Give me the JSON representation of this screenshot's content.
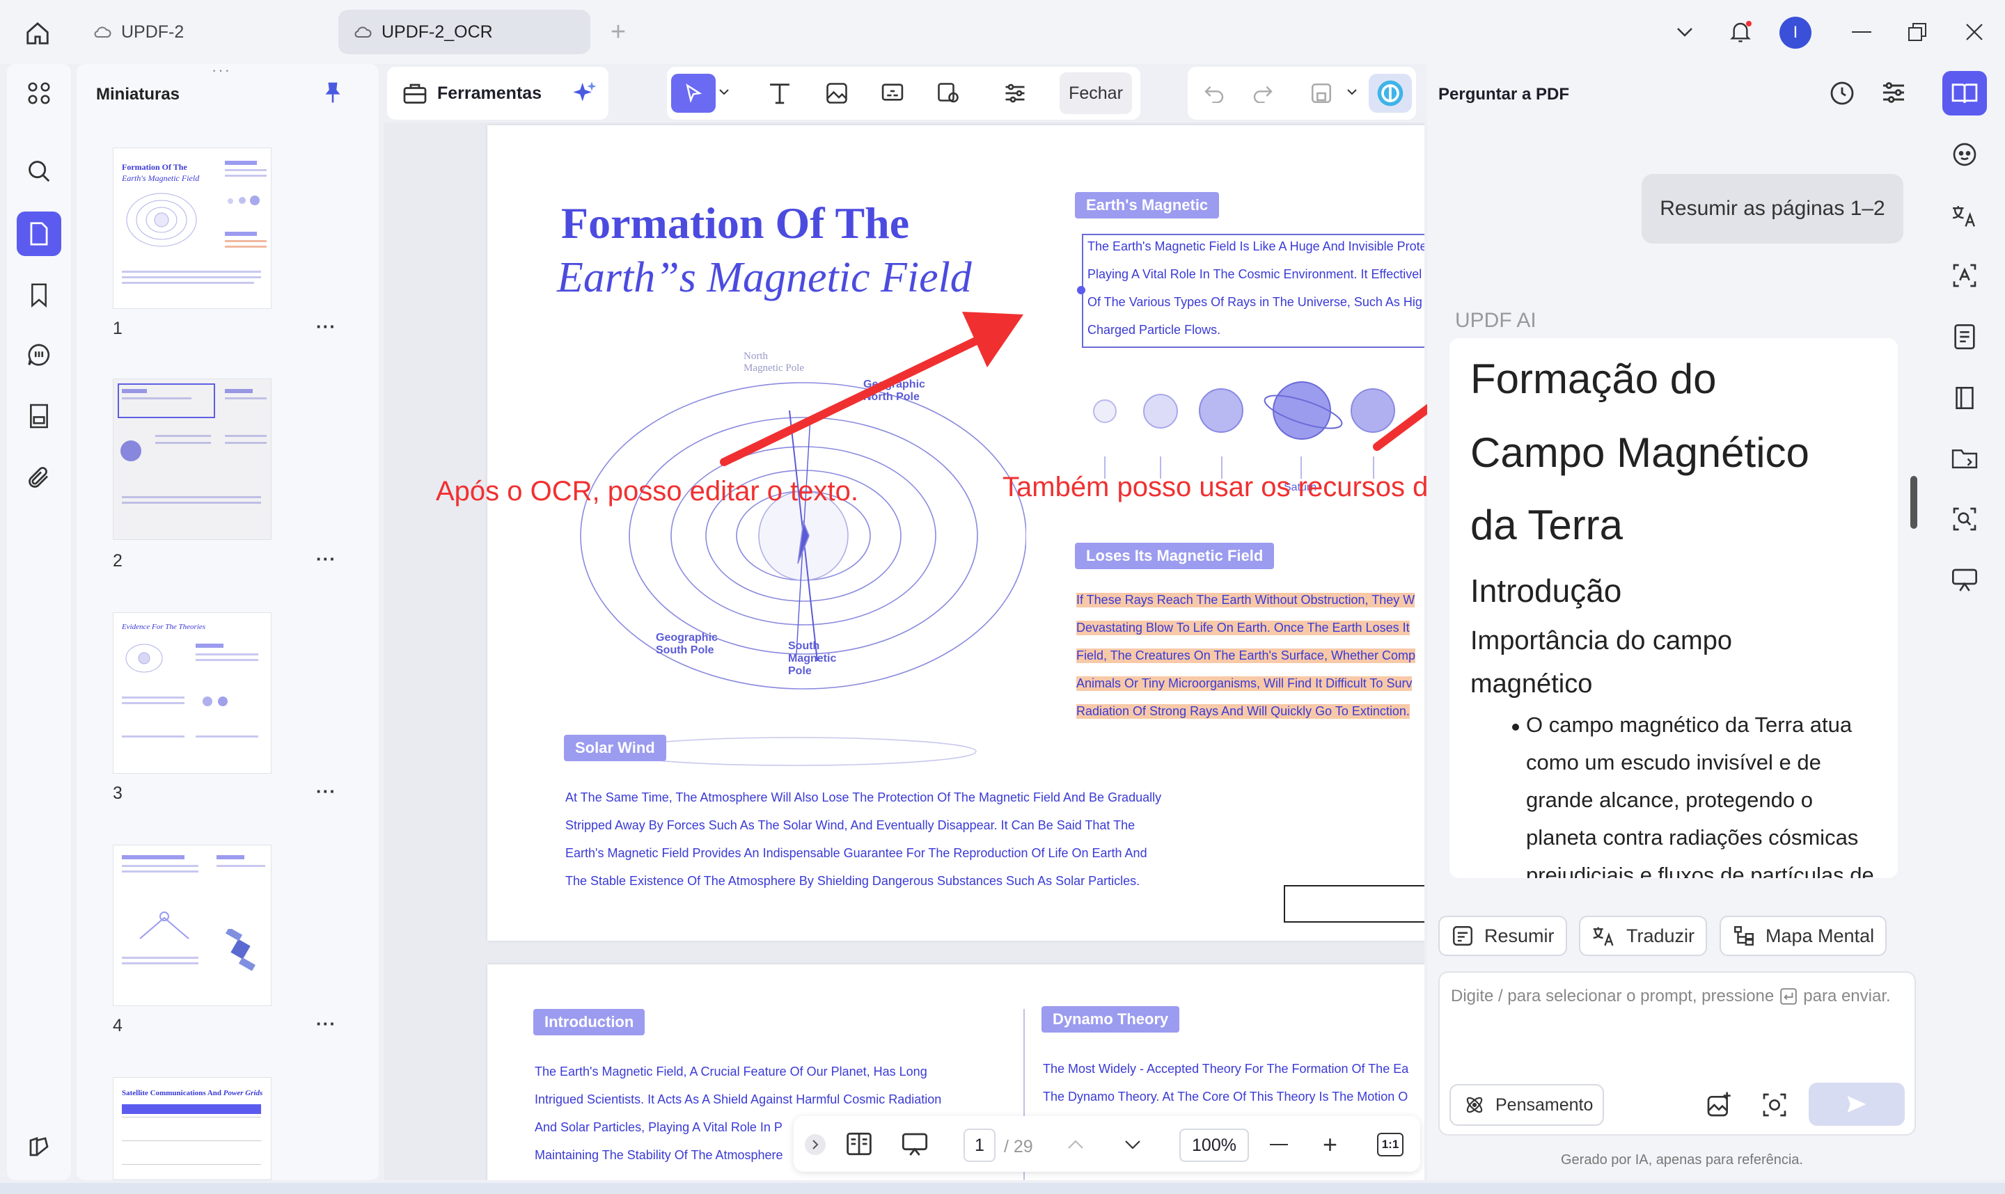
{
  "tabs": [
    {
      "label": "UPDF-2",
      "active": false
    },
    {
      "label": "UPDF-2_OCR",
      "active": true
    }
  ],
  "user_avatar": "I",
  "thumbnails_panel": {
    "title": "Miniaturas",
    "pages": [
      "1",
      "2",
      "3",
      "4"
    ],
    "more": "···"
  },
  "toolbar": {
    "tools_label": "Ferramentas",
    "close_label": "Fechar"
  },
  "document": {
    "page1": {
      "title_line1": "Formation Of The",
      "title_line2": "Earth”s Magnetic Field",
      "earth_pill": "Earth's Magnetic",
      "earth_text": [
        "The Earth's Magnetic Field Is Like A Huge And Invisible Prote",
        "Playing A Vital Role In The Cosmic Environment. It Effectivel",
        "Of The Various Types Of Rays in The Universe, Such As Hig",
        "Charged Particle Flows."
      ],
      "diagram_labels": {
        "north_magnetic": "North\nMagnetic Pole",
        "geo_north": "Geographic\nNorth Pole",
        "geo_south": "Geographic\nSouth Pole",
        "south_magnetic": "South\nMagnetic\nPole"
      },
      "planet_labels": [
        "",
        "",
        "",
        "Saturn",
        "",
        ""
      ],
      "loses_pill": "Loses Its Magnetic Field",
      "loses_text": [
        "If These Rays Reach The Earth Without Obstruction, They W",
        "Devastating Blow To Life On Earth. Once The Earth Loses It",
        "Field, The Creatures On The Earth's Surface, Whether Comp",
        "Animals Or Tiny Microorganisms, Will Find It Difficult To Surv",
        "Radiation Of Strong Rays And Will Quickly Go To Extinction."
      ],
      "solar_pill": "Solar Wind",
      "solar_text": [
        "At The Same Time, The Atmosphere Will Also Lose The Protection Of The Magnetic Field And Be Gradually",
        "Stripped Away By Forces Such As The Solar Wind, And Eventually Disappear. It Can Be Said That The",
        "Earth's Magnetic Field Provides An Indispensable Guarantee For The Reproduction Of Life On Earth And",
        "The Stable Existence Of The Atmosphere By Shielding Dangerous Substances Such As Solar Particles."
      ]
    },
    "page2": {
      "intro_pill": "Introduction",
      "intro_text": [
        "The Earth's Magnetic Field, A Crucial Feature Of Our Planet, Has Long",
        "Intrigued Scientists. It Acts As A Shield Against Harmful Cosmic Radiation",
        "And Solar Particles, Playing A Vital Role In P",
        "Maintaining The Stability Of The Atmosphere"
      ],
      "dynamo_pill": "Dynamo Theory",
      "dynamo_text": [
        "The Most Widely - Accepted Theory For The Formation Of The Ea",
        "The Dynamo Theory. At The Core Of This Theory Is The Motion O"
      ]
    }
  },
  "annotations": {
    "left": "Após o OCR, posso editar o texto.",
    "right": "Também posso usar os recursos de IA depois de executar o OCR."
  },
  "page_nav": {
    "current": "1",
    "total": "/ 29",
    "zoom": "100%"
  },
  "ai_panel": {
    "title": "Perguntar a PDF",
    "user_message": "Resumir as páginas 1–2",
    "assistant_label": "UPDF AI",
    "response": {
      "h1_line1": "Formação do",
      "h1_line2": "Campo Magnético",
      "h1_line3": "da Terra",
      "h2": "Introdução",
      "h3_line1": "Importância do campo",
      "h3_line2": "magnético",
      "bullet_lines": [
        "O campo magnético da Terra atua",
        "como um escudo invisível e de",
        "grande alcance, protegendo o",
        "planeta contra radiações cósmicas",
        "prejudiciais e fluxos de partículas de"
      ]
    },
    "chips": [
      "Resumir",
      "Traduzir",
      "Mapa Mental"
    ],
    "input_placeholder": "Digite / para selecionar o prompt, pressione",
    "input_placeholder_end": "para enviar.",
    "thinking_label": "Pensamento",
    "disclaimer": "Gerado por IA, apenas para referência."
  },
  "colors": {
    "accent": "#5b5bf0",
    "doc_text": "#3a3ad6",
    "annotation": "#f03030",
    "highlight": "#f8c9a8"
  }
}
